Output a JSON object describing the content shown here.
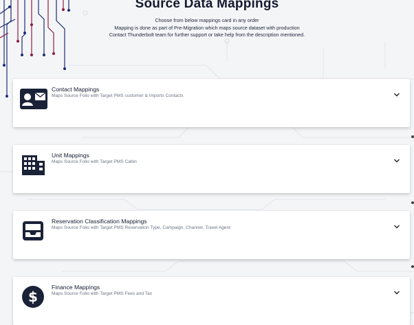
{
  "header": {
    "title": "Source Data Mappings",
    "line1": "Choose from below mappings card in any order",
    "line2": "Mapping is done as part of Pre-Migration which maps source dataset with production",
    "line3": "Contact Thunderbolt team for further support or take help from the description mentioned."
  },
  "cards": [
    {
      "title": "Contact Mappings",
      "description": "Maps Source Folio with Target PMS customer & Imports Contacts",
      "icon": "contact-card-icon"
    },
    {
      "title": "Unit Mappings",
      "description": "Maps Source Folio with Target PMS Cabin",
      "icon": "building-icon"
    },
    {
      "title": "Reservation Classification Mappings",
      "description": "Maps Source Folio with Target PMS Reservation Type, Campaign, Channel, Travel Agent",
      "icon": "inbox-tray-icon"
    },
    {
      "title": "Finance Mappings",
      "description": "Maps Source Folio with Target PMS Fees and Tax",
      "icon": "dollar-icon"
    }
  ],
  "colors": {
    "background": "#f4f5f7",
    "card": "#ffffff",
    "icon": "#1a2238",
    "circuit_red": "#8b1e3f",
    "circuit_blue": "#1e2a78"
  }
}
